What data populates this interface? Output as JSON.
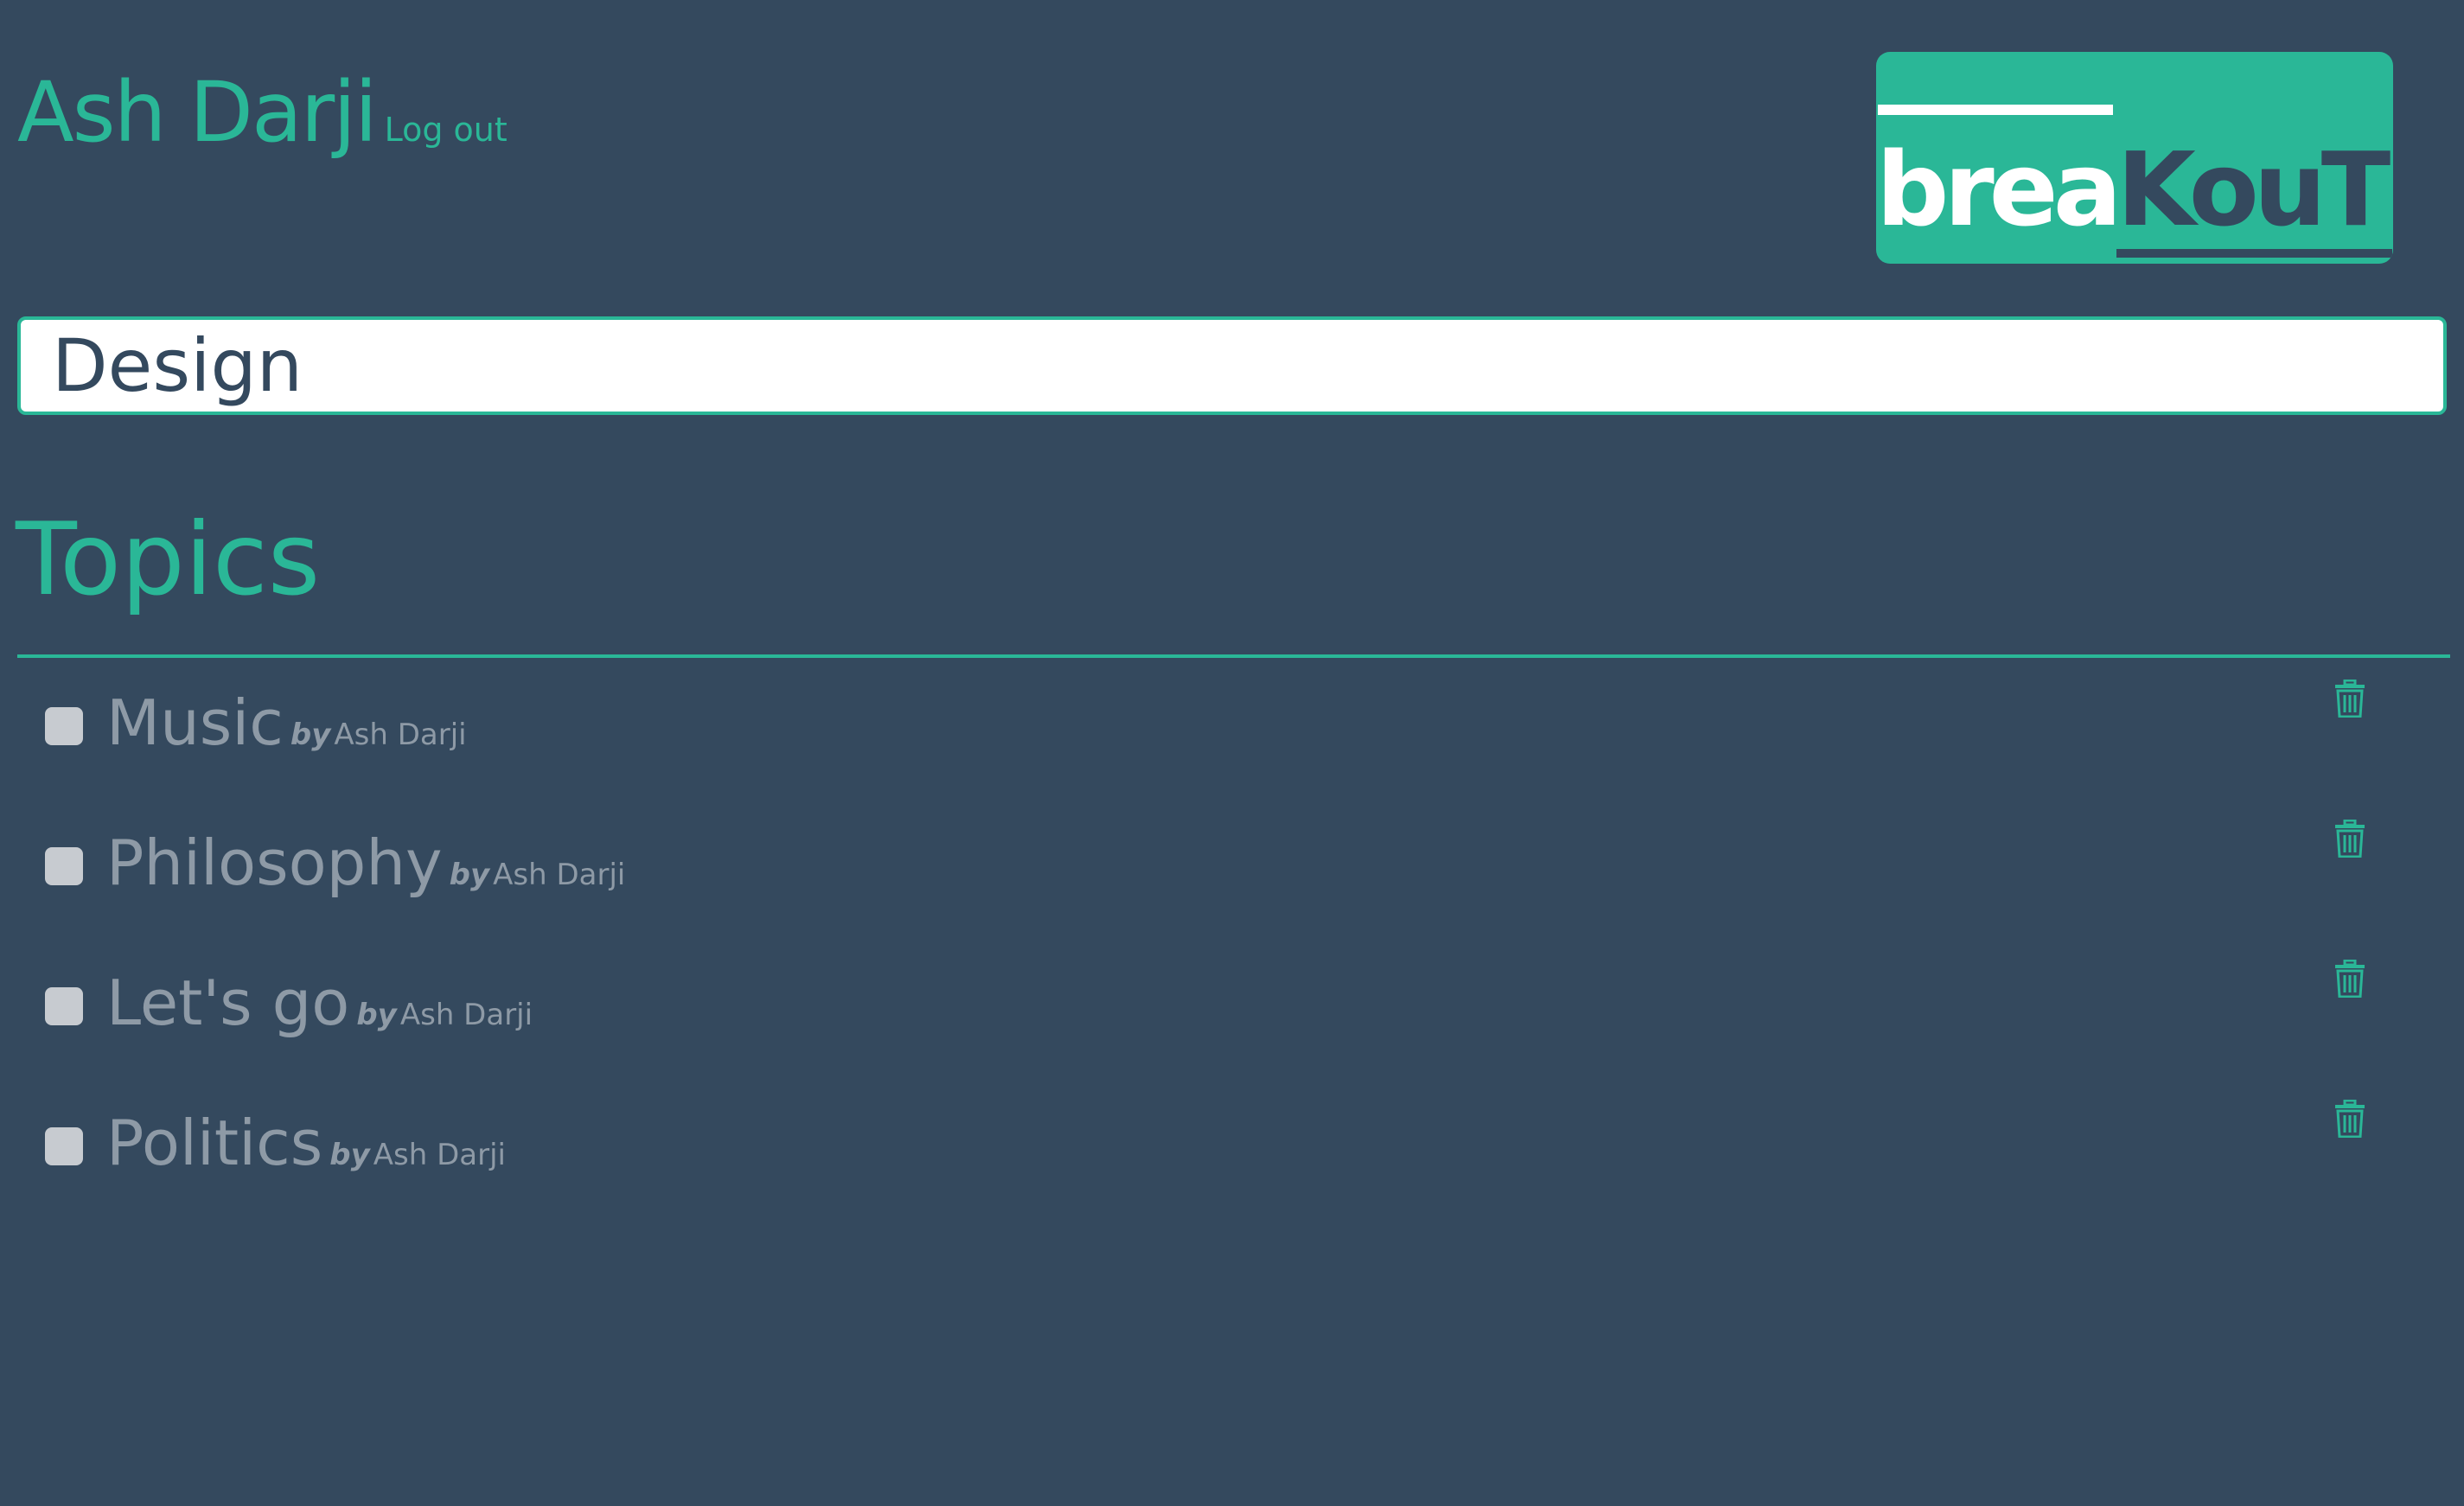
{
  "header": {
    "user_name": "Ash Darji",
    "logout_label": "Log out"
  },
  "logo": {
    "part_1": "brea",
    "part_2": "KouT"
  },
  "input": {
    "value": "Design"
  },
  "topics_section": {
    "title": "Topics",
    "items": [
      {
        "title": "Music",
        "by_label": "by",
        "author": "Ash Darji"
      },
      {
        "title": "Philosophy",
        "by_label": "by",
        "author": "Ash Darji"
      },
      {
        "title": "Let's go",
        "by_label": "by",
        "author": "Ash Darji"
      },
      {
        "title": "Politics",
        "by_label": "by",
        "author": "Ash Darji"
      }
    ]
  },
  "icons": {
    "delete": "trash-icon"
  },
  "colors": {
    "background": "#34495e",
    "accent": "#2ab797",
    "muted_text": "#8e9aa6",
    "checkbox": "#c7cbd0",
    "white": "#ffffff"
  }
}
